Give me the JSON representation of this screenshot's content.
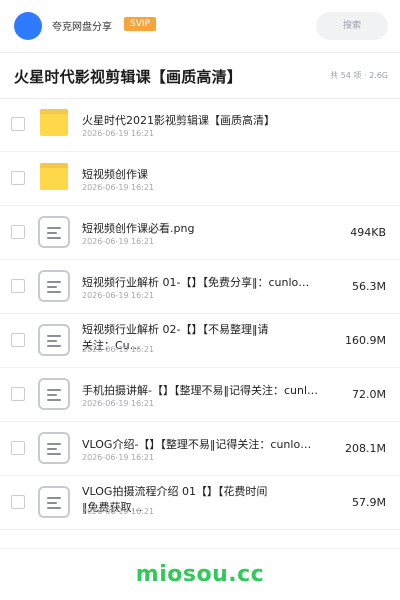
{
  "header": {
    "brand": "夸克网盘分享",
    "badge": "SVIP",
    "search_label": "搜索"
  },
  "folder": {
    "title": "火星时代影视剪辑课【画质高清】",
    "meta": "共 54 项 · 2.6G"
  },
  "files": [
    {
      "name": "火星时代2021影视剪辑课【画质高清】",
      "date": "2026-06-19 16:21",
      "size": "",
      "icon": "folder-icon"
    },
    {
      "name": "短视频创作课",
      "date": "2026-06-19 16:21",
      "size": "",
      "icon": "folder-icon"
    },
    {
      "name": "短视频创作课必看.png",
      "date": "2026-06-19 16:21",
      "size": "494KB",
      "icon": "file-icon"
    },
    {
      "name": "短视频行业解析 01-【】【免费分享‖：cunlo…",
      "date": "2026-06-19 16:21",
      "size": "56.3M",
      "icon": "file-icon"
    },
    {
      "name": "短视频行业解析 02-【】【不易整理‖请关注：Cu…",
      "date": "2026-06-19 16:21",
      "size": "160.9M",
      "icon": "file-icon"
    },
    {
      "name": "手机拍摄讲解-【】【整理不易‖记得关注：cunlo…",
      "date": "2026-06-19 16:21",
      "size": "72.0M",
      "icon": "file-icon"
    },
    {
      "name": "VLOG介绍-【】【整理不易‖记得关注：cunlo…",
      "date": "2026-06-19 16:21",
      "size": "208.1M",
      "icon": "file-icon"
    },
    {
      "name": "VLOG拍摄流程介绍 01【】【花费时间‖免费获取…",
      "date": "2026-06-19 16:21",
      "size": "57.9M",
      "icon": "file-icon"
    }
  ],
  "watermark": "miosou.cc",
  "colors": {
    "accent": "#2f7bff",
    "svip": "#f7a53a",
    "folder": "#ffd84a",
    "watermark": "#32c85a"
  }
}
